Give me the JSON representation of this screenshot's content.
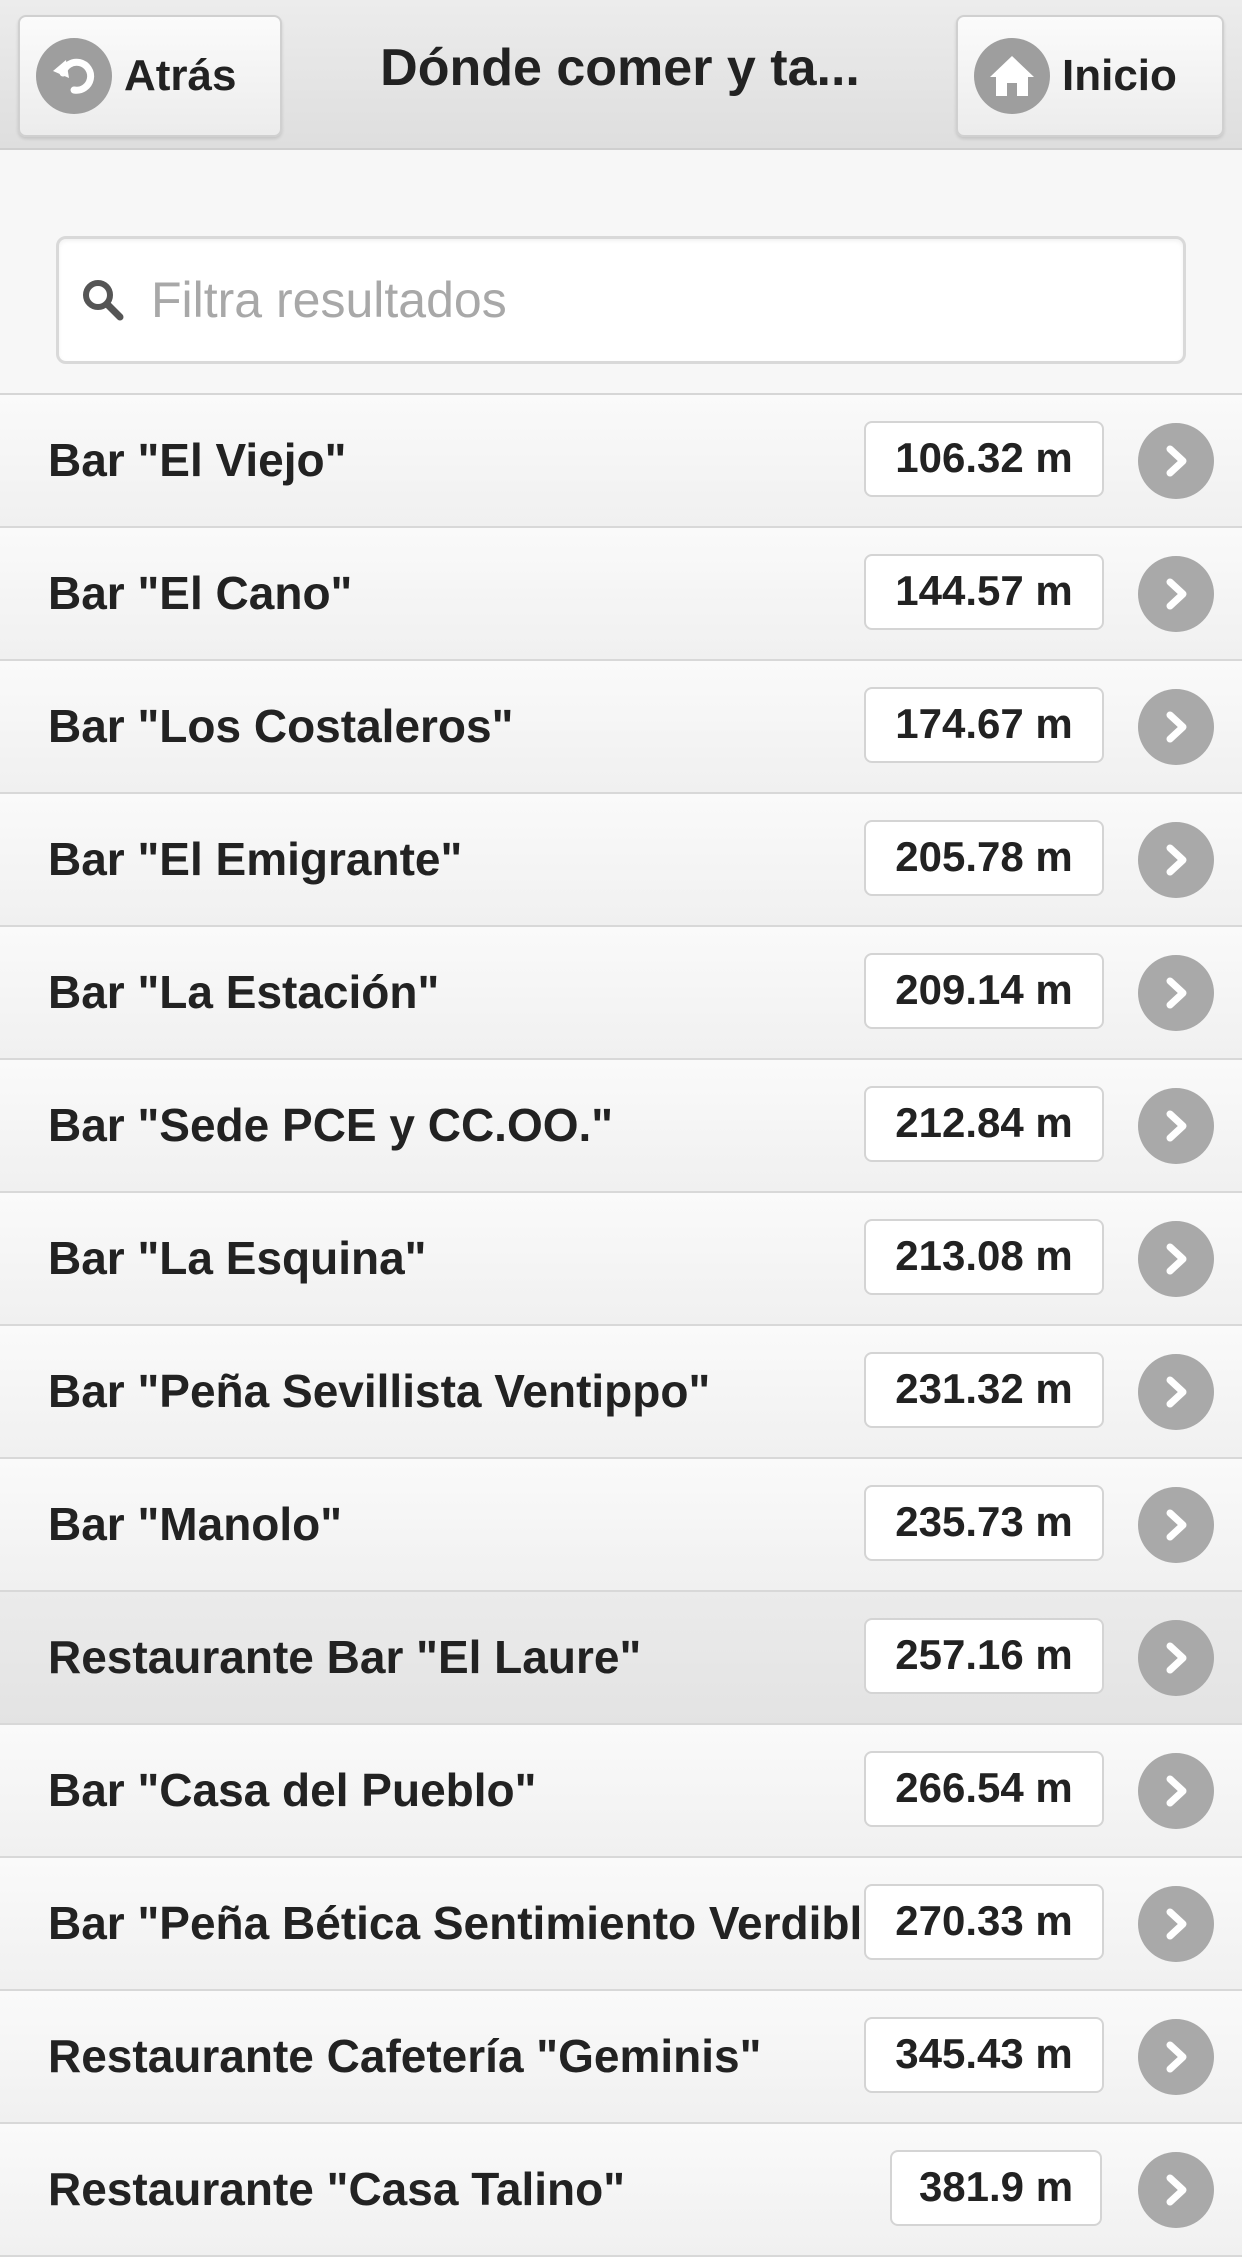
{
  "header": {
    "back_label": "Atrás",
    "title": "Dónde comer y ta...",
    "home_label": "Inicio"
  },
  "search": {
    "placeholder": "Filtra resultados"
  },
  "list": [
    {
      "name": "Bar \"El Viejo\"",
      "distance": "106.32 m"
    },
    {
      "name": "Bar \"El Cano\"",
      "distance": "144.57 m"
    },
    {
      "name": "Bar \"Los Costaleros\"",
      "distance": "174.67 m"
    },
    {
      "name": "Bar \"El Emigrante\"",
      "distance": "205.78 m"
    },
    {
      "name": "Bar \"La Estación\"",
      "distance": "209.14 m"
    },
    {
      "name": "Bar \"Sede PCE y CC.OO.\"",
      "distance": "212.84 m"
    },
    {
      "name": "Bar \"La Esquina\"",
      "distance": "213.08 m"
    },
    {
      "name": "Bar \"Peña Sevillista Ventippo\"",
      "distance": "231.32 m"
    },
    {
      "name": "Bar \"Manolo\"",
      "distance": "235.73 m"
    },
    {
      "name": "Restaurante Bar \"El Laure\"",
      "distance": "257.16 m"
    },
    {
      "name": "Bar \"Casa del Pueblo\"",
      "distance": "266.54 m"
    },
    {
      "name": "Bar \"Peña Bética Sentimiento Verdiblanco\"",
      "distance": "270.33 m"
    },
    {
      "name": "Restaurante Cafetería \"Geminis\"",
      "distance": "345.43 m"
    },
    {
      "name": "Restaurante \"Casa Talino\"",
      "distance": "381.9 m"
    }
  ],
  "colors": {
    "icon_gray": "#a9a9a9",
    "header_bg": "#e4e4e4",
    "active_row_bg": "#e7e7e7"
  }
}
